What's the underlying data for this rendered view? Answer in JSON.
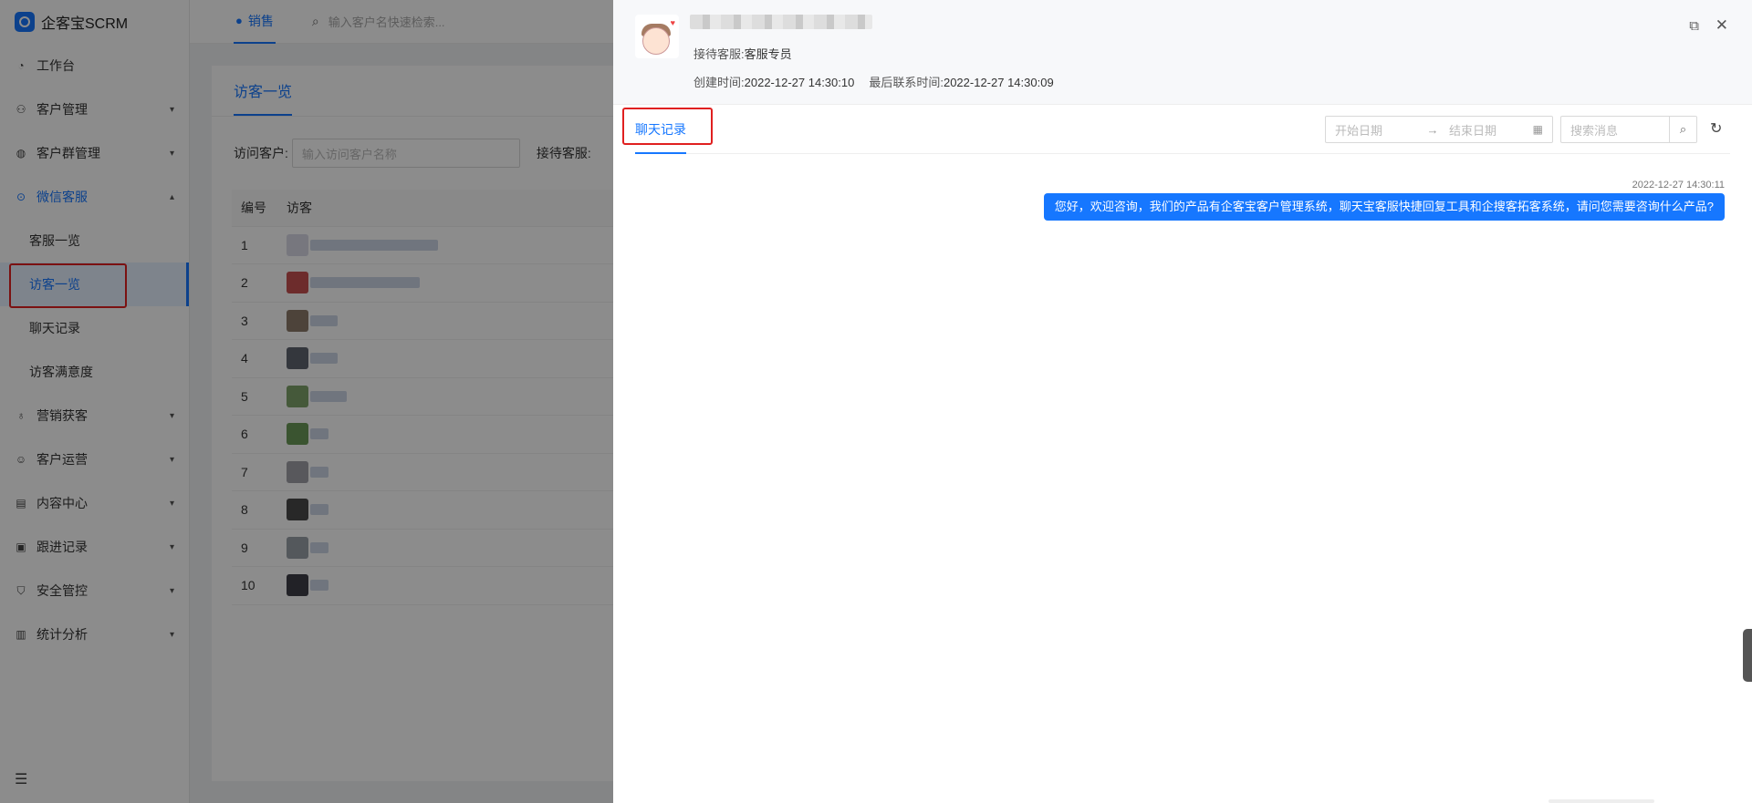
{
  "app": {
    "logo_text": "企客宝SCRM",
    "colors": {
      "primary": "#1677ff",
      "highlight_border": "#e02020"
    }
  },
  "sidebar": {
    "items": [
      {
        "label": "工作台",
        "icon": "dashboard-icon"
      },
      {
        "label": "客户管理",
        "icon": "user-icon"
      },
      {
        "label": "客户群管理",
        "icon": "group-chat-icon"
      },
      {
        "label": "微信客服",
        "icon": "chat-bubble-icon",
        "open": true
      },
      {
        "label": "营销获客",
        "icon": "bulb-icon"
      },
      {
        "label": "客户运营",
        "icon": "smile-icon"
      },
      {
        "label": "内容中心",
        "icon": "content-icon"
      },
      {
        "label": "跟进记录",
        "icon": "record-icon"
      },
      {
        "label": "安全管控",
        "icon": "shield-icon"
      },
      {
        "label": "统计分析",
        "icon": "bar-chart-icon"
      }
    ],
    "submenu": [
      "客服一览",
      "访客一览",
      "聊天记录",
      "访客满意度"
    ]
  },
  "topbar": {
    "tab_label": "销售",
    "search_placeholder": "输入客户名快速检索..."
  },
  "content": {
    "tab_label": "访客一览",
    "filter_visitor_label": "访问客户:",
    "filter_visitor_placeholder": "输入访问客户名称",
    "filter_agent_label": "接待客服:",
    "table_headers": [
      "编号",
      "访客"
    ],
    "rows": [
      "1",
      "2",
      "3",
      "4",
      "5",
      "6",
      "7",
      "8",
      "9",
      "10"
    ]
  },
  "drawer": {
    "agent_label": "接待客服:",
    "agent_value": "客服专员",
    "created_label": "创建时间:",
    "created_value": "2022-12-27 14:30:10",
    "last_contact_label": "最后联系时间:",
    "last_contact_value": "2022-12-27 14:30:09",
    "tab_label": "聊天记录",
    "start_date_placeholder": "开始日期",
    "end_date_placeholder": "结束日期",
    "search_placeholder": "搜索消息",
    "message": {
      "time": "2022-12-27 14:30:11",
      "text": "您好，欢迎咨询，我们的产品有企客宝客户管理系统，聊天宝客服快捷回复工具和企搜客拓客系统，请问您需要咨询什么产品?"
    }
  }
}
